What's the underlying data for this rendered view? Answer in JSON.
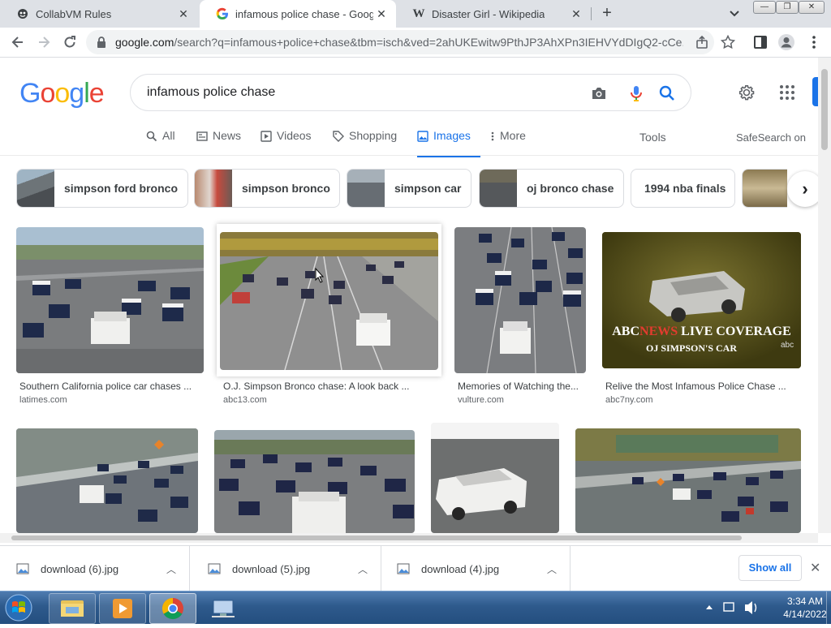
{
  "browser": {
    "tabs": [
      {
        "title": "CollabVM Rules",
        "favicon": "collabvm-icon",
        "active": false
      },
      {
        "title": "infamous police chase - Google S",
        "favicon": "google-g-icon",
        "active": true
      },
      {
        "title": "Disaster Girl - Wikipedia",
        "favicon": "wikipedia-w-icon",
        "active": false
      }
    ],
    "new_tab_label": "+",
    "url_host": "google.com",
    "url_path": "/search?q=infamous+police+chase&tbm=isch&ved=2ahUKEwitw9PthJP3AhXPn3IEHVYdDIgQ2-cCe..."
  },
  "google": {
    "logo_letters": [
      "G",
      "o",
      "o",
      "g",
      "l",
      "e"
    ],
    "logo_colors": [
      "#4285F4",
      "#EA4335",
      "#FBBC05",
      "#4285F4",
      "#34A853",
      "#EA4335"
    ],
    "query": "infamous police chase",
    "nav": {
      "all": "All",
      "news": "News",
      "videos": "Videos",
      "shopping": "Shopping",
      "images": "Images",
      "more": "More",
      "tools": "Tools",
      "safesearch": "SafeSearch on"
    },
    "chips": [
      "simpson ford bronco",
      "simpson bronco",
      "simpson car",
      "oj bronco chase",
      "1994 nba finals"
    ],
    "results_row1": [
      {
        "caption": "Southern California police car chases ...",
        "source": "latimes.com"
      },
      {
        "caption": "O.J. Simpson Bronco chase: A look back ...",
        "source": "abc13.com"
      },
      {
        "caption": "Memories of Watching the...",
        "source": "vulture.com"
      },
      {
        "caption": "Relive the Most Infamous Police Chase ...",
        "source": "abc7ny.com"
      }
    ],
    "abc_overlay": {
      "line1_a": "ABC",
      "line1_b": "NEWS",
      "line1_c": " LIVE COVERAGE",
      "line2": "OJ SIMPSON'S CAR",
      "bug": "abc"
    }
  },
  "downloads": {
    "items": [
      "download (6).jpg",
      "download (5).jpg",
      "download (4).jpg"
    ],
    "show_all": "Show all"
  },
  "taskbar": {
    "time": "3:34 AM",
    "date": "4/14/2022"
  },
  "colors": {
    "accent": "#1a73e8",
    "tabstrip": "#dee1e6"
  }
}
